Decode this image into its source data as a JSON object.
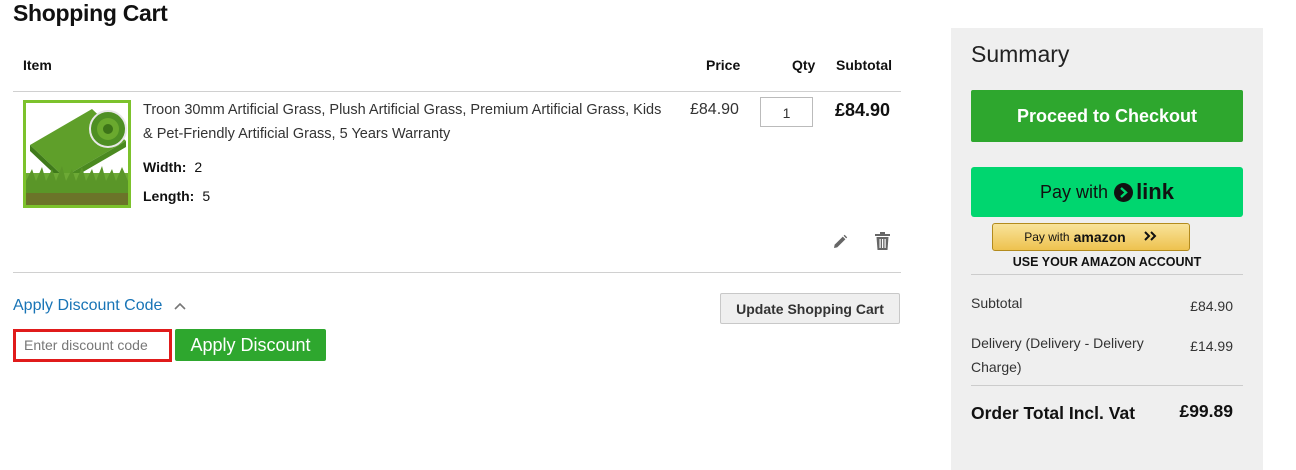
{
  "page": {
    "title": "Shopping Cart"
  },
  "cart": {
    "headers": {
      "item": "Item",
      "price": "Price",
      "qty": "Qty",
      "subtotal": "Subtotal"
    },
    "items": [
      {
        "name": "Troon 30mm Artificial Grass, Plush Artificial Grass, Premium Artificial Grass, Kids & Pet-Friendly Artificial Grass, 5 Years Warranty",
        "options": [
          {
            "label": "Width:",
            "value": "2"
          },
          {
            "label": "Length:",
            "value": "5"
          }
        ],
        "price": "£84.90",
        "qty": "1",
        "subtotal": "£84.90",
        "image": "artificial-grass-roll",
        "edit_icon": "pencil-icon",
        "delete_icon": "trash-icon"
      }
    ],
    "update_label": "Update Shopping Cart"
  },
  "discount": {
    "toggle_label": "Apply Discount Code",
    "toggle_icon": "chevron-up-icon",
    "placeholder": "Enter discount code",
    "button_label": "Apply Discount"
  },
  "summary": {
    "title": "Summary",
    "checkout_label": "Proceed to Checkout",
    "link_pay_with": "Pay with",
    "link_brand": "link",
    "amazon_pay_with": "Pay with",
    "amazon_brand": "amazon",
    "amazon_caption": "USE YOUR AMAZON ACCOUNT",
    "subtotal_label": "Subtotal",
    "subtotal_value": "£84.90",
    "delivery_label": "Delivery (Delivery - Delivery Charge)",
    "delivery_value": "£14.99",
    "total_label": "Order Total Incl. Vat",
    "total_value": "£99.89"
  },
  "colors": {
    "primary_green": "#2ea72e",
    "link_green": "#00d66f",
    "link_blue": "#1874b6",
    "highlight_red": "#e01b1b",
    "amazon_gold": "#eec24f"
  }
}
